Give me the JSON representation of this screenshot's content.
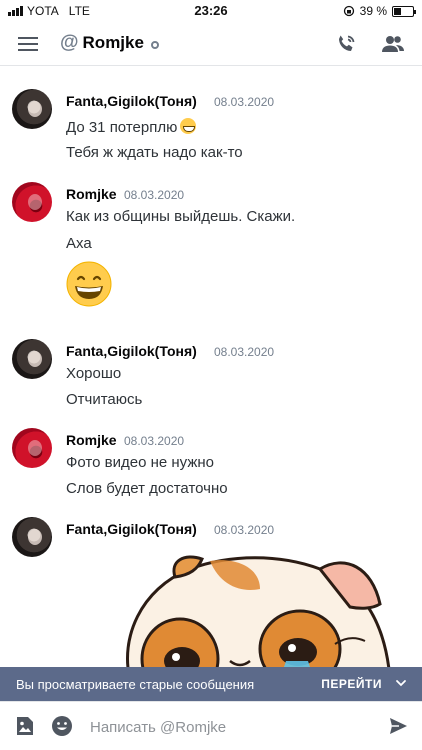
{
  "status_bar": {
    "carrier": "YOTA",
    "network": "LTE",
    "time": "23:26",
    "battery": "39 %",
    "battery_level": 0.39
  },
  "header": {
    "menu_icon": "hamburger-icon",
    "at_symbol": "@",
    "channel_name": "Romjke",
    "call_icon": "phone-call-icon",
    "members_icon": "members-icon"
  },
  "messages": [
    {
      "author": "Fanta,Gigilok(Тоня)",
      "date": "08.03.2020",
      "lines": [
        "До 31 потерплю",
        "Тебя ж ждать надо как-то"
      ]
    },
    {
      "author": "Romjke",
      "date": "08.03.2020",
      "lines": [
        "Как из общины выйдешь. Скажи.",
        "Аха"
      ]
    },
    {
      "author": "Fanta,Gigilok(Тоня)",
      "date": "08.03.2020",
      "lines": [
        "Хорошо",
        "Отчитаюсь"
      ]
    },
    {
      "author": "Romjke",
      "date": "08.03.2020",
      "lines": [
        "Фото видео не нужно",
        "Слов будет достаточно"
      ]
    },
    {
      "author": "Fanta,Gigilok(Тоня)",
      "date": "08.03.2020",
      "lines": []
    }
  ],
  "old_messages_bar": {
    "text": "Вы просматриваете старые сообщения",
    "action": "ПЕРЕЙТИ"
  },
  "input": {
    "placeholder": "Написать @Romjke",
    "value": ""
  },
  "colors": {
    "old_bar_bg": "#5c6a8a",
    "muted": "#747f8d"
  }
}
